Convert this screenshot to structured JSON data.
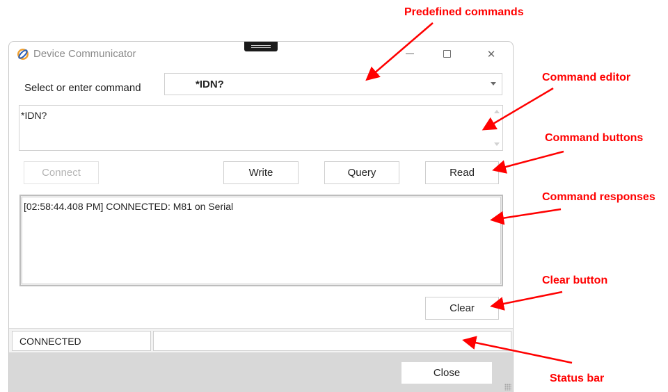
{
  "window": {
    "title": "Device Communicator",
    "icon": "device-communicator-app-icon",
    "caption_buttons": [
      "minimize-icon",
      "maximize-icon",
      "close-icon"
    ]
  },
  "command_selector": {
    "label": "Select or enter command",
    "selected": "*IDN?"
  },
  "command_editor": {
    "text": "*IDN?"
  },
  "buttons": {
    "connect": "Connect",
    "write": "Write",
    "query": "Query",
    "read": "Read",
    "clear": "Clear",
    "close": "Close"
  },
  "responses": [
    "[02:58:44.408 PM] CONNECTED: M81 on Serial"
  ],
  "status_bar": {
    "state": "CONNECTED",
    "message": ""
  },
  "annotations": {
    "predefined": "Predefined commands",
    "editor": "Command editor",
    "buttons": "Command buttons",
    "responses": "Command responses",
    "clear": "Clear button",
    "status": "Status bar"
  },
  "colors": {
    "annotation": "#ff0000",
    "status_bar_bg": "#f3f3f3",
    "bottom_panel_bg": "#d8d8d8",
    "disabled_text": "#b4b4b4"
  }
}
